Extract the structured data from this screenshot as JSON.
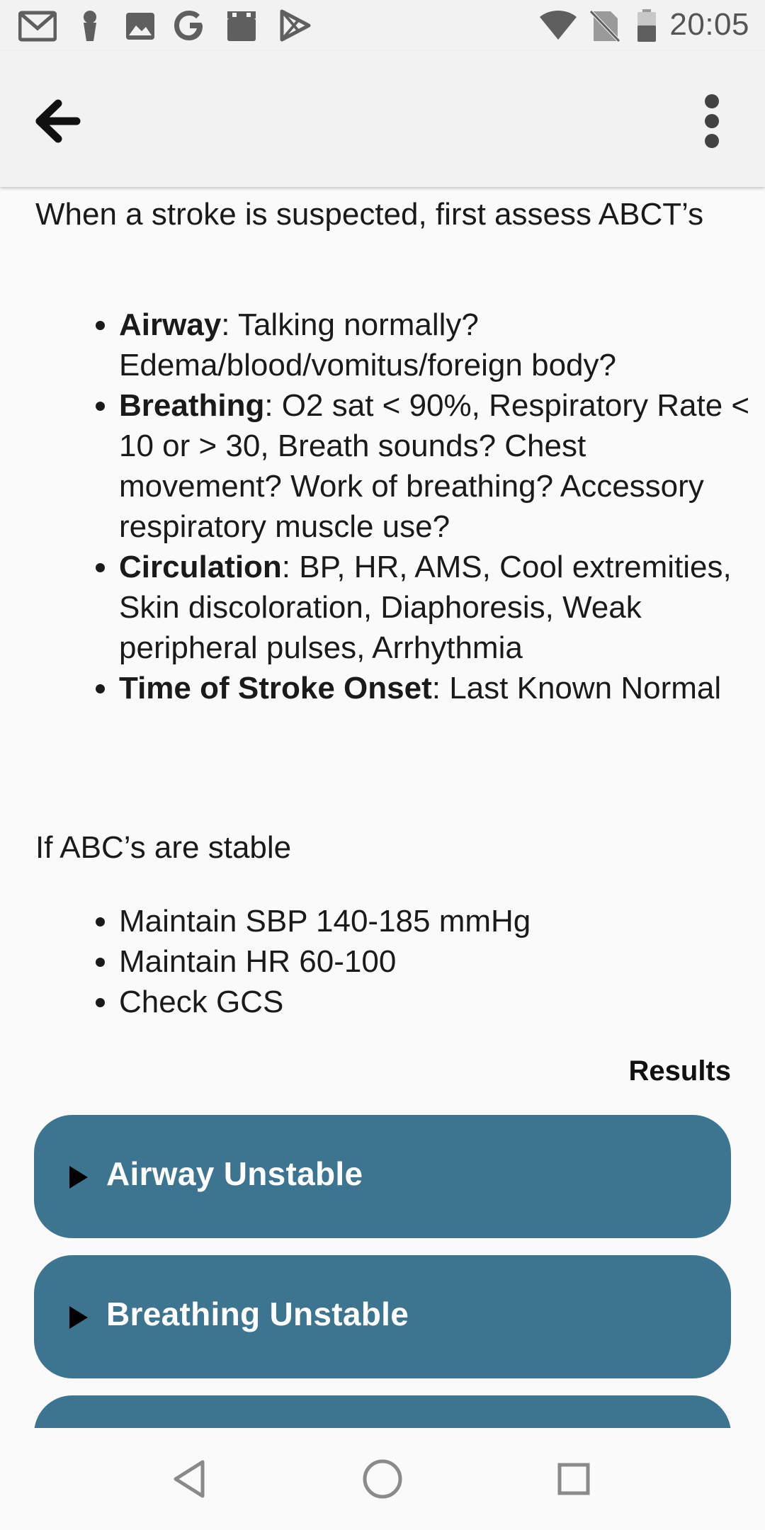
{
  "status_bar": {
    "time": "20:05",
    "left_icons": [
      "gmail-icon",
      "pin-icon",
      "image-icon",
      "google-icon",
      "app-icon",
      "play-store-icon"
    ],
    "right_icons": [
      "wifi-icon",
      "no-sim-icon",
      "battery-icon"
    ]
  },
  "app_bar": {
    "back_icon": "arrow-back-icon",
    "menu_icon": "more-vert-icon"
  },
  "content": {
    "intro": "When a stroke is suspected, first assess ABCT’s",
    "abc_items": [
      {
        "term": "Airway",
        "text": ": Talking normally? Edema/blood/vomitus/foreign body?"
      },
      {
        "term": "Breathing",
        "text": ": O2 sat < 90%, Respiratory Rate < 10 or > 30, Breath sounds? Chest movement? Work of breathing? Accessory respiratory muscle use?"
      },
      {
        "term": "Circulation",
        "text": ": BP, HR, AMS, Cool extremities, Skin discoloration, Diaphoresis, Weak peripheral pulses, Arrhythmia"
      },
      {
        "term": "Time of Stroke Onset",
        "text": ": Last Known Normal"
      }
    ],
    "stable_intro": "If ABC’s are stable",
    "stable_items": [
      "Maintain SBP 140-185 mmHg",
      "Maintain HR 60-100",
      "Check GCS"
    ],
    "results_label": "Results",
    "result_cards": [
      {
        "label": "Airway Unstable"
      },
      {
        "label": "Breathing Unstable"
      },
      {
        "label": ""
      }
    ]
  },
  "colors": {
    "card_background": "#3d7590",
    "app_bar_background": "#f2f2f2"
  },
  "nav_bar": {
    "icons": [
      "back-triangle-icon",
      "home-circle-icon",
      "recents-square-icon"
    ]
  }
}
